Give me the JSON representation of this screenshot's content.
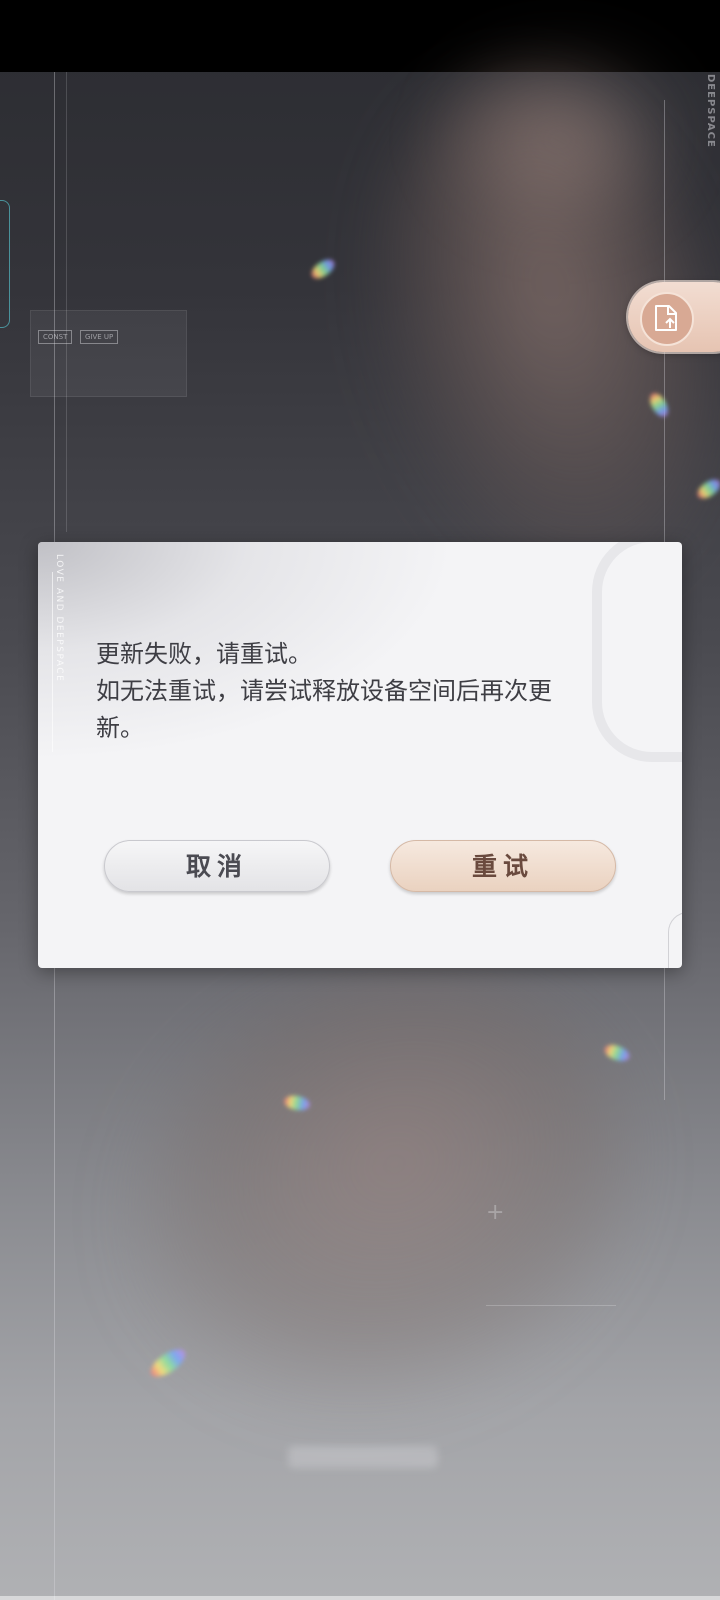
{
  "background": {
    "brand_vertical": "DEEPSPACE",
    "panel_chips": [
      "CONST",
      "GIVE UP"
    ],
    "panel_caption": "",
    "dialog_side_text": "LOVE AND DEEPSPACE",
    "lower_label": ""
  },
  "share_button": {
    "icon": "file-upload-icon"
  },
  "dialog": {
    "message_lines": [
      "更新失败，请重试。",
      "如无法重试，请尝试释放设备空间后再次更",
      "新。"
    ],
    "cancel_label": "取消",
    "retry_label": "重试"
  },
  "colors": {
    "dialog_bg": "#f4f4f6",
    "cancel_bg": "#e8e8eb",
    "retry_bg": "#efdccd",
    "share_accent": "#d8a994",
    "text": "#3e3e44"
  }
}
